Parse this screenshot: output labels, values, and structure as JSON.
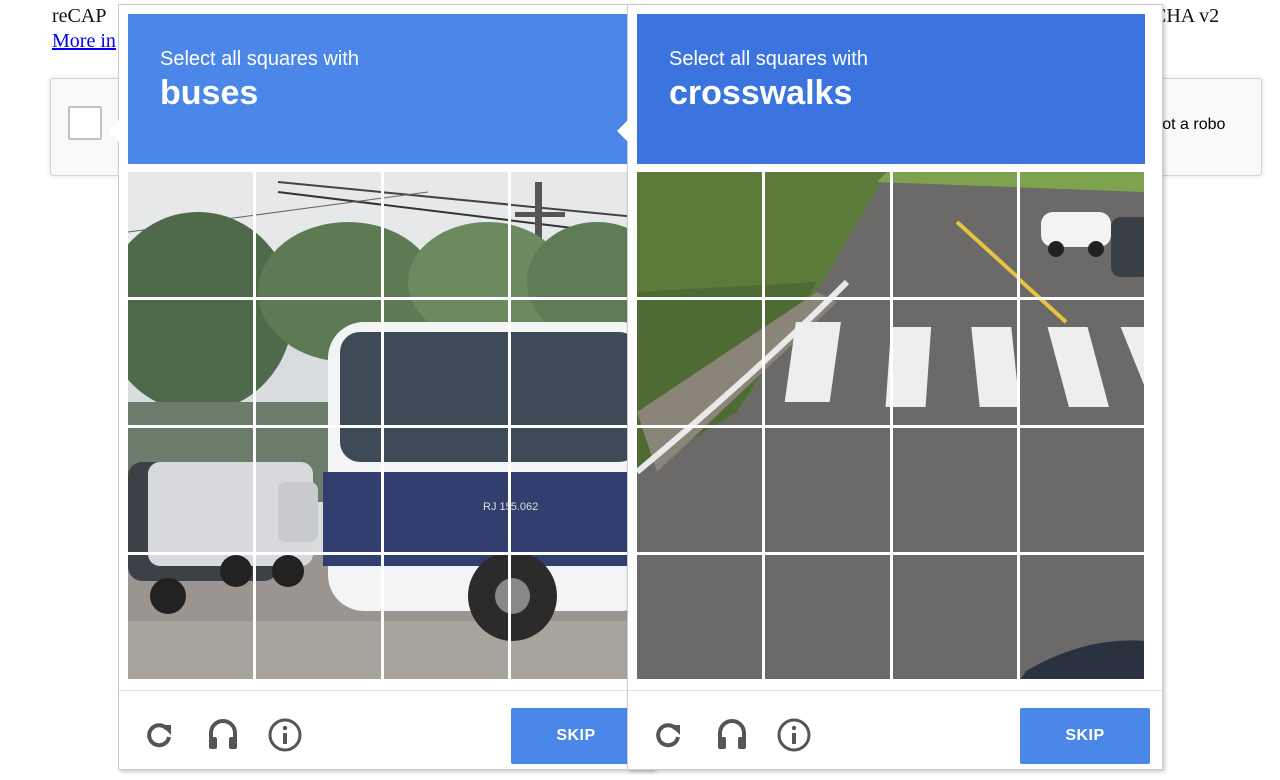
{
  "page": {
    "heading_left": "reCAP",
    "heading_right": "CHA v2",
    "more_info_link": "More in"
  },
  "anchor": {
    "checkbox_label": "n not a robo"
  },
  "challenges": [
    {
      "prompt": "Select all squares with",
      "keyword": "buses",
      "grid_size": 4,
      "tile_count": 16,
      "scene_text": "RJ 155.062",
      "icons": [
        "reload-icon",
        "audio-icon",
        "info-icon"
      ],
      "skip_label": "SKIP",
      "accent_color": "#4a87e8"
    },
    {
      "prompt": "Select all squares with",
      "keyword": "crosswalks",
      "grid_size": 4,
      "tile_count": 16,
      "icons": [
        "reload-icon",
        "audio-icon",
        "info-icon"
      ],
      "skip_label": "SKIP",
      "accent_color": "#4a87e8"
    }
  ]
}
